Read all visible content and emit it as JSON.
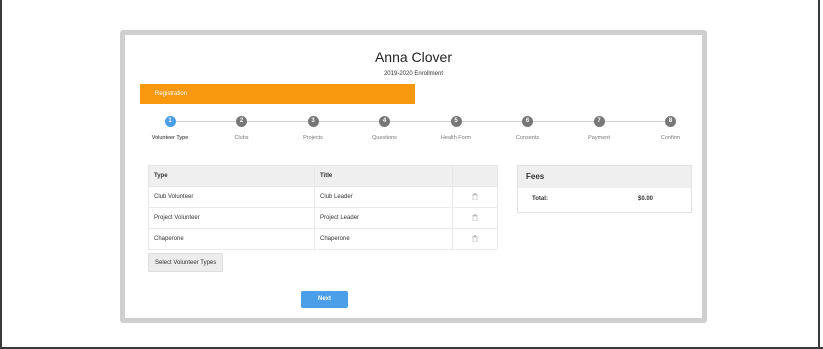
{
  "header": {
    "student_name": "Anna Clover",
    "enrollment_label": "2019-2020 Enrollment"
  },
  "banner": {
    "label": "Registration"
  },
  "steps": [
    {
      "number": "1",
      "label": "Volunteer Type",
      "active": true
    },
    {
      "number": "2",
      "label": "Clubs",
      "active": false
    },
    {
      "number": "3",
      "label": "Projects",
      "active": false
    },
    {
      "number": "4",
      "label": "Questions",
      "active": false
    },
    {
      "number": "5",
      "label": "Health Form",
      "active": false
    },
    {
      "number": "6",
      "label": "Consents",
      "active": false
    },
    {
      "number": "7",
      "label": "Payment",
      "active": false
    },
    {
      "number": "8",
      "label": "Confirm",
      "active": false
    }
  ],
  "volunteer_table": {
    "columns": [
      "Type",
      "Title",
      ""
    ],
    "rows": [
      {
        "type": "Club Volunteer",
        "title": "Club Leader",
        "icon": "trash-icon"
      },
      {
        "type": "Project Volunteer",
        "title": "Project Leader",
        "icon": "trash-icon"
      },
      {
        "type": "Chaperone",
        "title": "Chaperone",
        "icon": "trash-icon"
      }
    ]
  },
  "select_button": {
    "label": "Select Volunteer Types"
  },
  "fees": {
    "title": "Fees",
    "total_label": "Total:",
    "total_value": "$0.00"
  },
  "next_button": {
    "label": "Next"
  },
  "colors": {
    "accent_orange": "#f7980f",
    "accent_blue": "#4a9fe8",
    "step_inactive": "#777777"
  }
}
